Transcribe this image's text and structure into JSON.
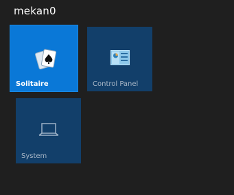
{
  "start": {
    "group_title": "mekan0",
    "tiles": [
      {
        "label": "Solitaire",
        "icon": "cards-icon",
        "color": "#0a78d7"
      },
      {
        "label": "Control Panel",
        "icon": "control-panel-icon",
        "color": "#123f6a"
      },
      {
        "label": "System",
        "icon": "laptop-icon",
        "color": "#123f6a"
      }
    ]
  }
}
